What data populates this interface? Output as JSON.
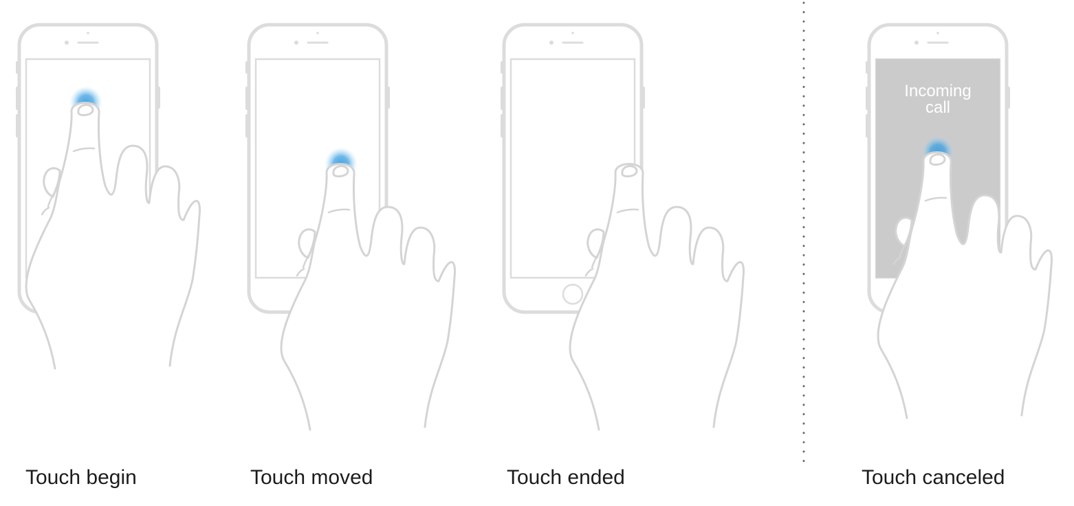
{
  "panels": [
    {
      "caption": "Touch begin"
    },
    {
      "caption": "Touch moved"
    },
    {
      "caption": "Touch ended"
    },
    {
      "caption": "Touch canceled",
      "overlay_line1": "Incoming",
      "overlay_line2": "call"
    }
  ],
  "colors": {
    "outline": "#dcdcdc",
    "hand_stroke": "#d4d4d4",
    "touch": "#3fa1e0",
    "overlay": "#cbcbcb",
    "caption": "#1c1c1e",
    "divider": "#6b6b6b"
  }
}
